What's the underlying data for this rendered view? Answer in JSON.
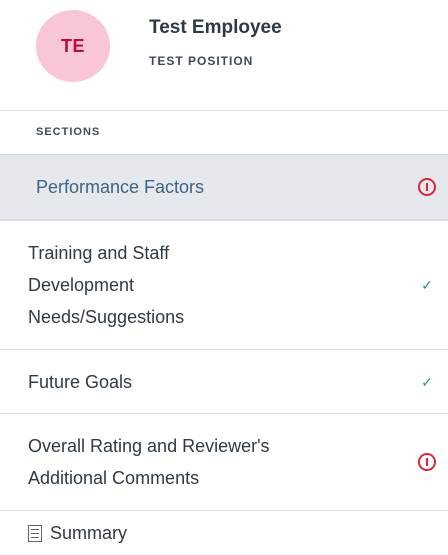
{
  "employee": {
    "initials": "TE",
    "name": "Test Employee",
    "position": "TEST POSITION"
  },
  "sections_label": "SECTIONS",
  "sections": [
    {
      "label": "Performance Factors",
      "status": "warning",
      "active": true
    },
    {
      "label": "Training and Staff Development Needs/Suggestions",
      "status": "complete",
      "active": false
    },
    {
      "label": "Future Goals",
      "status": "complete",
      "active": false
    },
    {
      "label": "Overall Rating and Reviewer's Additional Comments",
      "status": "warning",
      "active": false
    },
    {
      "label": "Summary",
      "icon": "document-icon",
      "active": false
    }
  ],
  "colors": {
    "avatar_bg": "#f9c6d6",
    "avatar_text": "#b3103f",
    "active_bg": "#e5e8ec",
    "active_text": "#3d6483",
    "warning": "#d8283b",
    "complete": "#2f9c63"
  }
}
